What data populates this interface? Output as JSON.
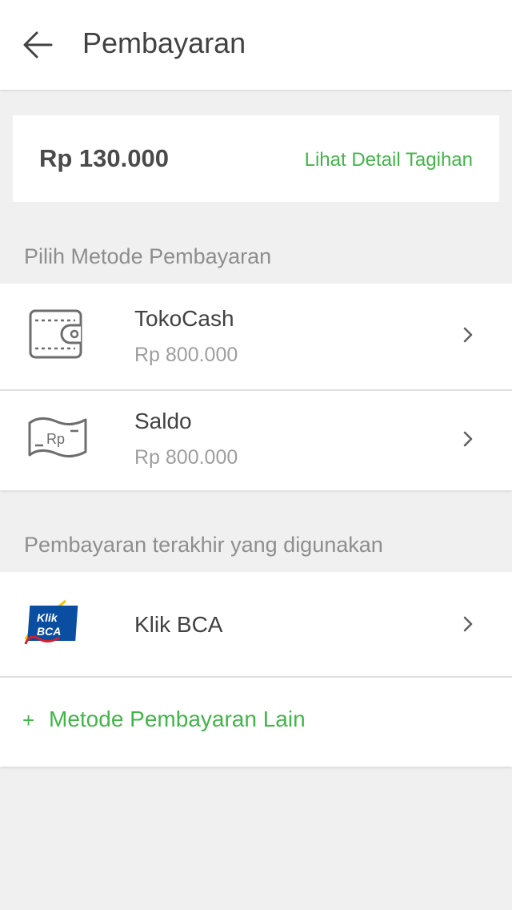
{
  "header": {
    "title": "Pembayaran",
    "back_icon": "arrow-left-icon"
  },
  "summary": {
    "total": "Rp 130.000",
    "detail_link": "Lihat Detail Tagihan"
  },
  "payment_methods": {
    "section_title": "Pilih Metode Pembayaran",
    "items": [
      {
        "icon": "wallet-icon",
        "name": "TokoCash",
        "balance": "Rp 800.000"
      },
      {
        "icon": "banknote-rp-icon",
        "name": "Saldo",
        "balance": "Rp 800.000"
      }
    ]
  },
  "recent": {
    "section_title": "Pembayaran terakhir yang digunakan",
    "items": [
      {
        "icon": "klikbca-logo",
        "name": "Klik BCA"
      }
    ],
    "add_symbol": "+",
    "add_label": "Metode Pembayaran Lain"
  },
  "colors": {
    "accent": "#42b549",
    "background": "#f0f0f0",
    "text_primary": "#424242",
    "text_secondary": "#9e9e9e"
  }
}
